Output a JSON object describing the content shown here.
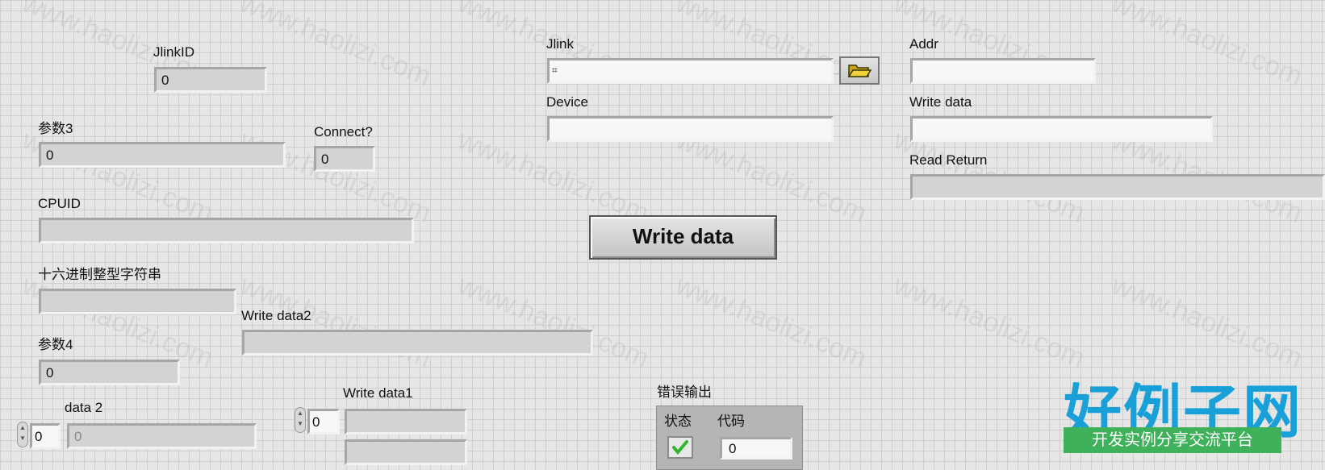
{
  "watermark": "www.haolizi.com",
  "labels": {
    "jlinkid": "JlinkID",
    "param3": "参数3",
    "connect": "Connect?",
    "cpuid": "CPUID",
    "hex_string": "十六进制整型字符串",
    "write_data2": "Write data2",
    "param4": "参数4",
    "data2": "data 2",
    "write_data1": "Write data1",
    "jlink": "Jlink",
    "device": "Device",
    "addr": "Addr",
    "write_data": "Write data",
    "read_return": "Read Return",
    "error_out": "错误输出",
    "status": "状态",
    "code": "代码"
  },
  "values": {
    "jlinkid": "0",
    "param3": "0",
    "connect": "0",
    "cpuid": "",
    "hex_string": "",
    "write_data2": "",
    "param4": "0",
    "data2_index": "0",
    "data2_value": "0",
    "write_data1_index": "0",
    "jlink_path": "",
    "device": "",
    "addr": "",
    "write_data": "",
    "read_return": "",
    "error_code": "0"
  },
  "button": {
    "write_label": "Write data"
  },
  "logo": {
    "main": "好例子网",
    "sub": "开发实例分享交流平台"
  },
  "colors": {
    "logo_blue": "#1aa0d8",
    "logo_green": "#3fb15a",
    "status_ok": "#2fb52f"
  },
  "icons": {
    "browse": "folder-open-icon",
    "path": "path-icon",
    "status": "check-icon"
  }
}
